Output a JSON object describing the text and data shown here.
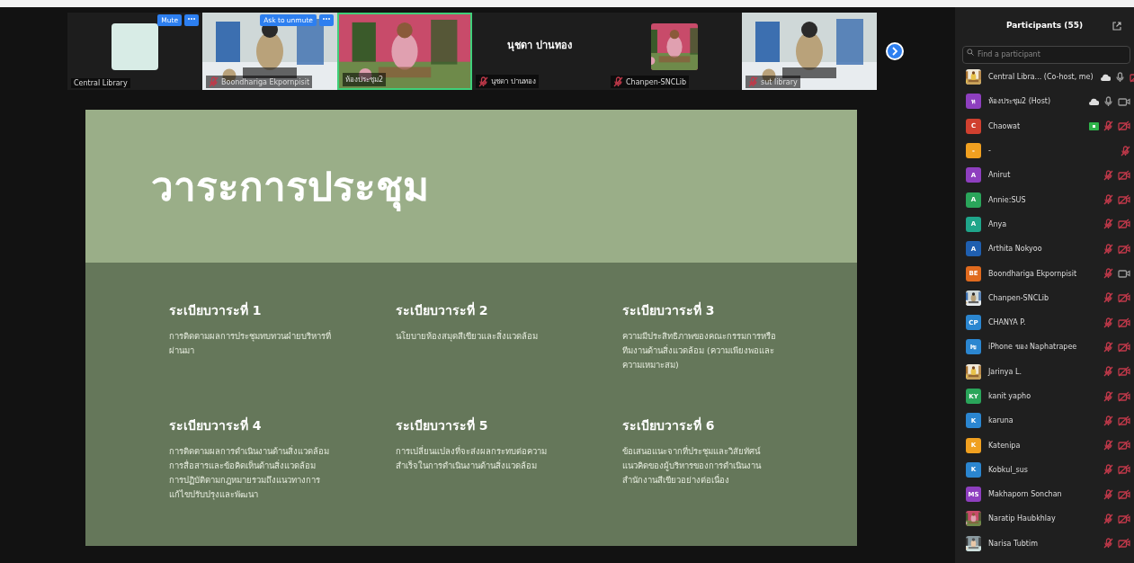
{
  "gallery": {
    "tiles": [
      {
        "kind": "logo",
        "name": "Central Library",
        "muted": false,
        "active": false,
        "buttons": [
          "Mute"
        ]
      },
      {
        "kind": "video",
        "name": "Boondhariga Ekpornpisit",
        "muted": true,
        "active": false,
        "buttons": [
          "Ask to unmute"
        ]
      },
      {
        "kind": "video",
        "name": "ห้องประชุม2",
        "muted": false,
        "active": true
      },
      {
        "kind": "name",
        "name": "นุชดา ปานทอง",
        "muted": true,
        "active": false,
        "display_name": "นุชดา ปานทอง"
      },
      {
        "kind": "avatar",
        "name": "Chanpen-SNCLib",
        "muted": true,
        "active": false
      },
      {
        "kind": "video",
        "name": "sut library",
        "muted": true,
        "active": false
      }
    ]
  },
  "slide": {
    "title": "วาระการประชุม",
    "items": [
      {
        "heading": "ระเบียบวาระที่ 1",
        "text": "การติดตามผลการประชุมทบทวนฝ่ายบริหารที่ผ่านมา"
      },
      {
        "heading": "ระเบียบวาระที่ 2",
        "text": "นโยบายห้องสมุดสีเขียวและสิ่งแวดล้อม"
      },
      {
        "heading": "ระเบียบวาระที่ 3",
        "text": "ความมีประสิทธิภาพของคณะกรรมการหรือทีมงานด้านสิ่งแวดล้อม (ความเพียงพอและความเหมาะสม)"
      },
      {
        "heading": "ระเบียบวาระที่ 4",
        "text": "การติดตามผลการดำเนินงานด้านสิ่งแวดล้อม การสื่อสารและข้อคิดเห็นด้านสิ่งแวดล้อม การปฏิบัติตามกฎหมายรวมถึงแนวทางการแก้ไขปรับปรุงและพัฒนา"
      },
      {
        "heading": "ระเบียบวาระที่ 5",
        "text": "การเปลี่ยนแปลงที่จะส่งผลกระทบต่อความสำเร็จในการดำเนินงานด้านสิ่งแวดล้อม"
      },
      {
        "heading": "ระเบียบวาระที่ 6",
        "text": "ข้อเสนอแนะจากที่ประชุมและวิสัยทัศน์แนวคิดของผู้บริหารของการดำเนินงานสำนักงานสีเขียวอย่างต่อเนื่อง"
      }
    ]
  },
  "participants": {
    "title": "Participants (55)",
    "search": {
      "placeholder": "Find a participant"
    },
    "items": [
      {
        "name": "Central Libra... (Co-host, me)",
        "muted": false,
        "camera": false,
        "cloud": true,
        "sharing": false
      },
      {
        "name": "ห้องประชุม2 (Host)",
        "kind": "initials",
        "initials": "ห",
        "color": "#8e3fbf",
        "muted": false,
        "camera": true,
        "cloud": true,
        "sharing": false
      },
      {
        "name": "Chaowat",
        "kind": "initials",
        "initials": "C",
        "color": "#d0402f",
        "muted": true,
        "camera": false,
        "cloud": false,
        "sharing": true
      },
      {
        "name": "-",
        "kind": "initials",
        "initials": "-",
        "color": "#f0a020",
        "muted": true,
        "cloud": false,
        "sharing": false
      },
      {
        "name": "Anirut",
        "kind": "initials",
        "initials": "A",
        "color": "#8e3fbf",
        "muted": true,
        "camera": false,
        "cloud": false,
        "sharing": false
      },
      {
        "name": "Annie:SUS",
        "kind": "initials",
        "initials": "A",
        "color": "#2aa55a",
        "muted": true,
        "camera": false,
        "cloud": false,
        "sharing": false
      },
      {
        "name": "Anya",
        "kind": "initials",
        "initials": "A",
        "color": "#1fa58a",
        "muted": true,
        "camera": false,
        "cloud": false,
        "sharing": false
      },
      {
        "name": "Arthita Nokyoo",
        "kind": "initials",
        "initials": "A",
        "color": "#1f5fb0",
        "muted": true,
        "camera": false,
        "cloud": false,
        "sharing": false
      },
      {
        "name": "Boondhariga Ekpornpisit",
        "kind": "initials",
        "initials": "BE",
        "color": "#e06a1e",
        "muted": true,
        "camera": true,
        "cloud": false,
        "sharing": false
      },
      {
        "name": "Chanpen-SNCLib",
        "muted": true,
        "camera": false,
        "cloud": false,
        "sharing": false
      },
      {
        "name": "CHANYA P.",
        "kind": "initials",
        "initials": "CP",
        "color": "#2b86d0",
        "muted": true,
        "camera": false,
        "cloud": false,
        "sharing": false
      },
      {
        "name": "iPhone ของ Naphatrapee",
        "kind": "initials",
        "initials": "Iข",
        "color": "#2b86d0",
        "muted": true,
        "camera": false,
        "cloud": false,
        "sharing": false
      },
      {
        "name": "Jarinya L.",
        "muted": true,
        "camera": false,
        "cloud": false,
        "sharing": false
      },
      {
        "name": "kanit yapho",
        "kind": "initials",
        "initials": "KY",
        "color": "#2aa55a",
        "muted": true,
        "camera": false,
        "cloud": false,
        "sharing": false
      },
      {
        "name": "karuna",
        "kind": "initials",
        "initials": "K",
        "color": "#2b86d0",
        "muted": true,
        "camera": false,
        "cloud": false,
        "sharing": false
      },
      {
        "name": "Katenipa",
        "kind": "initials",
        "initials": "K",
        "color": "#f0a020",
        "muted": true,
        "camera": false,
        "cloud": false,
        "sharing": false
      },
      {
        "name": "Kobkul_sus",
        "kind": "initials",
        "initials": "K",
        "color": "#2b86d0",
        "muted": true,
        "camera": false,
        "cloud": false,
        "sharing": false
      },
      {
        "name": "Makhaporn Sonchan",
        "kind": "initials",
        "initials": "MS",
        "color": "#8e3fbf",
        "muted": true,
        "camera": false,
        "cloud": false,
        "sharing": false
      },
      {
        "name": "Naratip Haubkhlay",
        "muted": true,
        "camera": false,
        "cloud": false,
        "sharing": false
      },
      {
        "name": "Narisa Tubtim",
        "muted": true,
        "camera": false,
        "cloud": false,
        "sharing": false
      }
    ]
  }
}
